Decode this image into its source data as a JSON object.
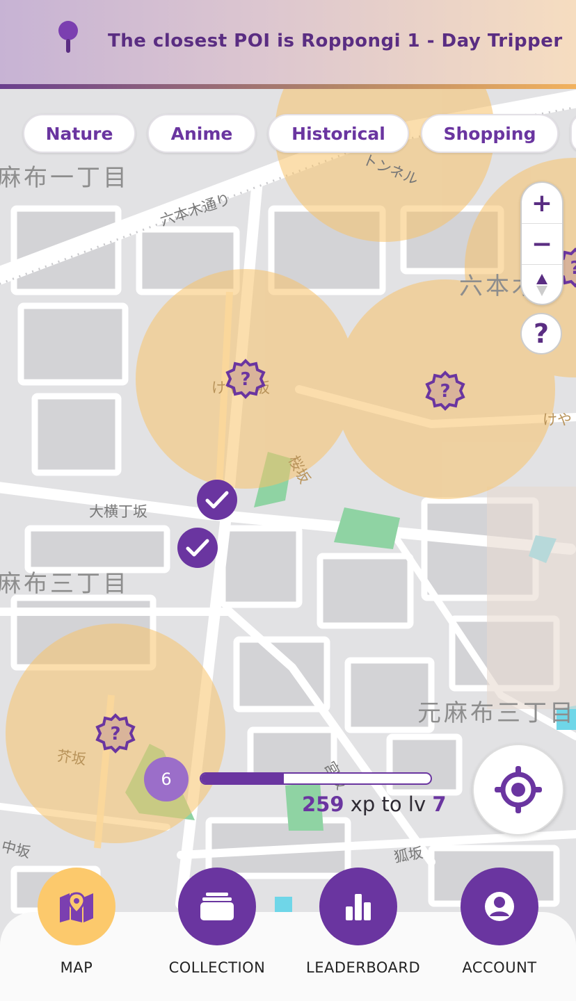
{
  "banner": {
    "icon": "map-pin-icon",
    "message": "The closest POI is Roppongi 1 - Day Tripper"
  },
  "filters": [
    "Nature",
    "Anime",
    "Historical",
    "Shopping"
  ],
  "map_labels": {
    "azabu1": "麻布一丁目",
    "roppongi_dori": "六本木通り",
    "tunnel": "トンネル",
    "roppongi": "六本木",
    "keyakizaka": "けやき坂",
    "keya": "けや",
    "sakurazaka": "桜坂",
    "ooyokocho": "大横丁坂",
    "azabu3": "麻布三丁目",
    "motoazabu3": "元麻布三丁目",
    "karashizaka": "芥坂",
    "miyazaka": "宮坂",
    "nakazaka": "中坂",
    "kitsunezaka": "狐坂"
  },
  "controls": {
    "zoom_in": "+",
    "zoom_out": "−",
    "help": "?"
  },
  "progress": {
    "level": "6",
    "xp_remaining": "259",
    "xp_text": "xp to lv",
    "next_level": "7",
    "fill_percent": 0.36
  },
  "nav": {
    "items": [
      {
        "label": "MAP",
        "icon": "map-icon",
        "active": true
      },
      {
        "label": "COLLECTION",
        "icon": "collection-icon",
        "active": false
      },
      {
        "label": "LEADERBOARD",
        "icon": "leaderboard-icon",
        "active": false
      },
      {
        "label": "ACCOUNT",
        "icon": "account-icon",
        "active": false
      }
    ]
  },
  "colors": {
    "brand": "#6a35a0",
    "accent": "#fcc96c",
    "poi_area": "#f7c878"
  }
}
